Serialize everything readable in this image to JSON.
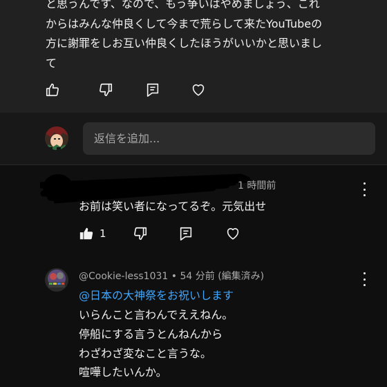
{
  "top_comment": {
    "text_lines": [
      "と思うんです、なので、もう争いはやめましょう、これ",
      "からはみんな仲良くして今まで荒らして来たYouTubeの",
      "方に謝罪をしお互い仲良くしたほうがいいかと思いまし",
      "て"
    ],
    "icons": [
      "thumbs-up-icon",
      "thumbs-down-icon",
      "reply-icon",
      "heart-icon"
    ]
  },
  "reply_box": {
    "placeholder": "返信を追加..."
  },
  "comment2": {
    "time": "1 時間前",
    "text": "お前は笑い者になってるぞ。元気出せ",
    "like_count": "1"
  },
  "comment3": {
    "author": "@Cookie-less1031",
    "separator": "•",
    "time": "54 分前",
    "edited": "(編集済み)",
    "mention": "@日本の大神祭をお祝いします",
    "lines": [
      "いらんこと言わんでええねん。",
      "停船にする言うとんねんから",
      "わざわざ変なこと言うな。",
      "喧嘩したいんか。"
    ]
  },
  "colors": {
    "background": "#0f0f0f",
    "card": "#212121",
    "input": "#2c2c2c",
    "mention": "#3ea6ff",
    "meta": "#aaaaaa"
  }
}
